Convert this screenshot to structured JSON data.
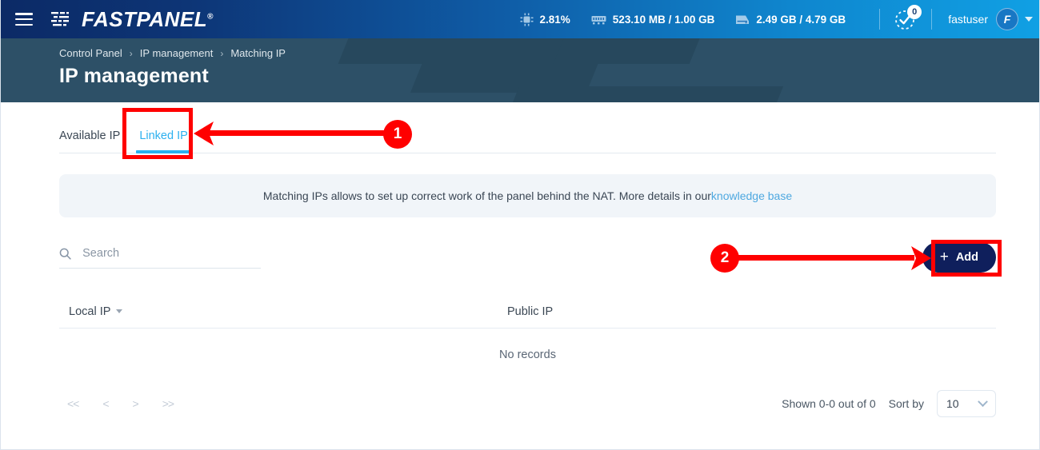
{
  "topbar": {
    "menu_icon": "hamburger-icon",
    "brand": "FASTPANEL",
    "brand_reg": "®",
    "stats": [
      {
        "icon": "cpu-icon",
        "value": "2.81%"
      },
      {
        "icon": "memory-icon",
        "value": "523.10 MB / 1.00 GB"
      },
      {
        "icon": "disk-icon",
        "value": "2.49 GB / 4.79 GB"
      }
    ],
    "notifications": {
      "icon": "tasks-check-icon",
      "count": "0"
    },
    "user": {
      "name": "fastuser",
      "avatar_initial": "F"
    }
  },
  "banner": {
    "breadcrumbs": [
      {
        "label": "Control Panel"
      },
      {
        "label": "IP management"
      },
      {
        "label": "Matching IP"
      }
    ],
    "separator": "›",
    "title": "IP management"
  },
  "tabs": [
    {
      "label": "Available IP",
      "active": false
    },
    {
      "label": "Linked IP",
      "active": true
    }
  ],
  "notice": {
    "text": "Matching IPs allows to set up correct work of the panel behind the NAT. More details in our ",
    "link": "knowledge base"
  },
  "toolbar": {
    "search_placeholder": "Search",
    "search_value": "",
    "search_icon": "search-icon",
    "add_label": "Add",
    "add_plus": "+"
  },
  "table": {
    "columns": [
      "Local IP",
      "Public IP"
    ],
    "rows": [],
    "empty_text": "No records"
  },
  "footer": {
    "pager": [
      "<<",
      "<",
      ">",
      ">>"
    ],
    "shown": "Shown 0-0 out of 0",
    "sort_by_label": "Sort by",
    "page_size": "10"
  },
  "annotations": [
    {
      "number": "1",
      "target": "linked-ip-tab"
    },
    {
      "number": "2",
      "target": "add-button"
    }
  ],
  "colors": {
    "header_start": "#0c2a66",
    "header_end": "#10a0e4",
    "banner": "#2d5067",
    "tab_active": "#29b0ef",
    "add_button": "#0f1f5c",
    "annotation": "#ff0000",
    "notice_bg": "#f1f5f9"
  }
}
